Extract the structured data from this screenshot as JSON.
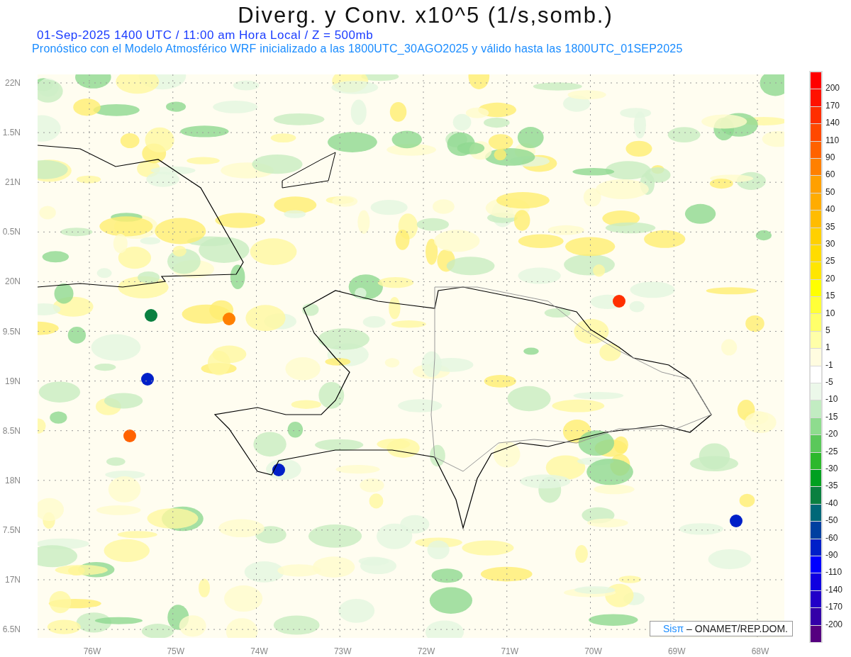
{
  "title": "Diverg. y Conv. x10^5 (1/s,somb.)",
  "subtitle_1": "01-Sep-2025  1400 UTC / 11:00 am Hora Local / Z = 500mb",
  "subtitle_2": "Pronóstico con el Modelo Atmosférico WRF inicializado a las 1800UTC_30AGO2025 y válido hasta las  1800UTC_01SEP2025",
  "y_axis_labels": [
    "22N",
    "1.5N",
    "21N",
    "0.5N",
    "20N",
    "9.5N",
    "19N",
    "8.5N",
    "18N",
    "7.5N",
    "17N",
    "6.5N"
  ],
  "x_axis_labels": [
    "76W",
    "75W",
    "74W",
    "73W",
    "72W",
    "71W",
    "70W",
    "69W",
    "68W"
  ],
  "colorbar": {
    "bins": [
      {
        "color": "#ff0000"
      },
      {
        "color": "#ff1200"
      },
      {
        "color": "#ff2e00"
      },
      {
        "color": "#ff4800"
      },
      {
        "color": "#ff6200"
      },
      {
        "color": "#ff8000"
      },
      {
        "color": "#ffa000"
      },
      {
        "color": "#ffac00"
      },
      {
        "color": "#ffbc00"
      },
      {
        "color": "#ffd000"
      },
      {
        "color": "#ffdc00"
      },
      {
        "color": "#ffe600"
      },
      {
        "color": "#ffff00"
      },
      {
        "color": "#ffff38"
      },
      {
        "color": "#ffff6a"
      },
      {
        "color": "#ffffa8"
      },
      {
        "color": "#fffce0"
      },
      {
        "color": "#ffffff"
      },
      {
        "color": "#ecf8ea"
      },
      {
        "color": "#c2ecc2"
      },
      {
        "color": "#8edc8e"
      },
      {
        "color": "#5ac85a"
      },
      {
        "color": "#2cb82c"
      },
      {
        "color": "#00a020"
      },
      {
        "color": "#0a8040"
      },
      {
        "color": "#006878"
      },
      {
        "color": "#0040a0"
      },
      {
        "color": "#0020c8"
      },
      {
        "color": "#0000ff"
      },
      {
        "color": "#1000e0"
      },
      {
        "color": "#2200c8"
      },
      {
        "color": "#3400a8"
      },
      {
        "color": "#560080"
      }
    ],
    "labels": [
      "200",
      "170",
      "140",
      "110",
      "90",
      "60",
      "50",
      "40",
      "35",
      "30",
      "25",
      "20",
      "15",
      "10",
      "5",
      "1",
      "-1",
      "-5",
      "-10",
      "-15",
      "-20",
      "-25",
      "-30",
      "-35",
      "-40",
      "-50",
      "-60",
      "-90",
      "-110",
      "-140",
      "-170",
      "-200"
    ]
  },
  "credit": {
    "logo": "Sisπ",
    "text": "– ONAMET/REP.DOM."
  }
}
